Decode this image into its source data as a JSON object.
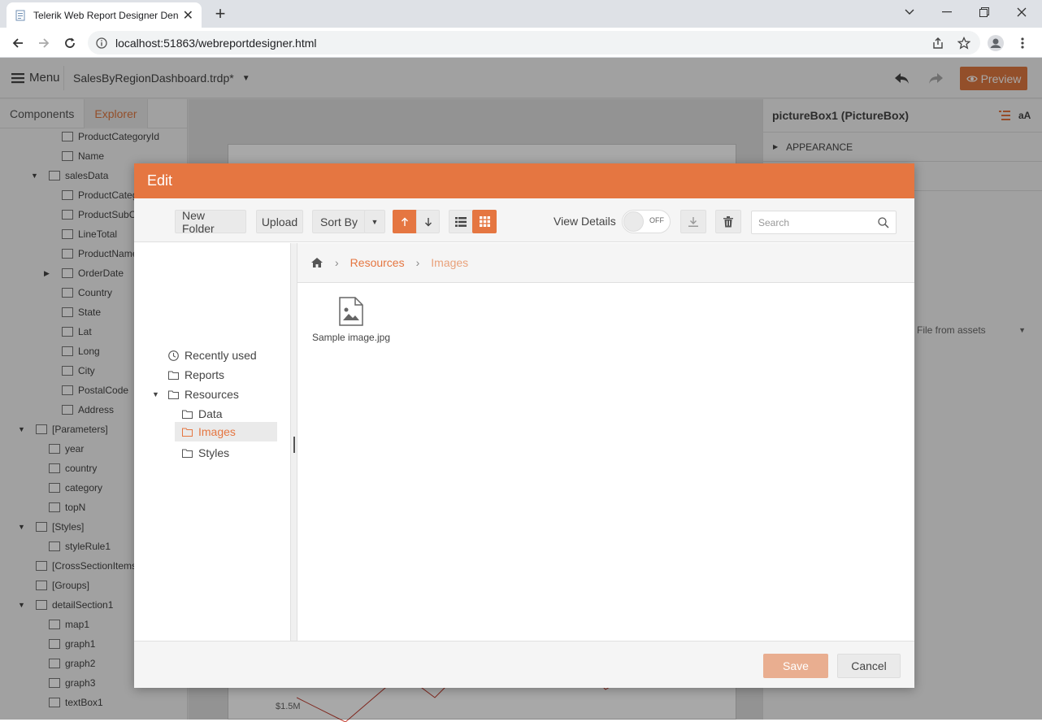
{
  "browser": {
    "tab_title": "Telerik Web Report Designer Den",
    "url": "localhost:51863/webreportdesigner.html"
  },
  "app": {
    "menu_label": "Menu",
    "report_name": "SalesByRegionDashboard.trdp*",
    "preview_label": "Preview",
    "left_tabs": [
      "Components",
      "Explorer"
    ],
    "explorer_items": [
      {
        "label": "ProductCategoryId",
        "icon": "123"
      },
      {
        "label": "Name",
        "icon": "abc"
      },
      {
        "label": "salesData",
        "icon": "db"
      },
      {
        "label": "ProductCateg",
        "icon": "abc"
      },
      {
        "label": "ProductSubCat",
        "icon": "abc"
      },
      {
        "label": "LineTotal",
        "icon": "0.1"
      },
      {
        "label": "ProductName",
        "icon": "abc"
      },
      {
        "label": "OrderDate",
        "icon": "date"
      },
      {
        "label": "Country",
        "icon": "abc"
      },
      {
        "label": "State",
        "icon": "abc"
      },
      {
        "label": "Lat",
        "icon": "0.1"
      },
      {
        "label": "Long",
        "icon": "0.1"
      },
      {
        "label": "City",
        "icon": "abc"
      },
      {
        "label": "PostalCode",
        "icon": "abc"
      },
      {
        "label": "Address",
        "icon": "abc"
      },
      {
        "label": "[Parameters]",
        "icon": "params"
      },
      {
        "label": "year",
        "icon": "123"
      },
      {
        "label": "country",
        "icon": "abc"
      },
      {
        "label": "category",
        "icon": "abc"
      },
      {
        "label": "topN",
        "icon": "123"
      },
      {
        "label": "[Styles]",
        "icon": "palette"
      },
      {
        "label": "styleRule1",
        "icon": "palette"
      },
      {
        "label": "[CrossSectionItems",
        "icon": "grid"
      },
      {
        "label": "[Groups]",
        "icon": "groups"
      },
      {
        "label": "detailSection1",
        "icon": "section"
      },
      {
        "label": "map1",
        "icon": "globe"
      },
      {
        "label": "graph1",
        "icon": "graph"
      },
      {
        "label": "graph2",
        "icon": "graph"
      },
      {
        "label": "graph3",
        "icon": "graph"
      },
      {
        "label": "textBox1",
        "icon": "abc"
      }
    ],
    "properties_title": "pictureBox1 (PictureBox)",
    "properties_icon_text": "aA",
    "appearance_label": "APPEARANCE",
    "source_select_value": "File from assets",
    "canvas_axis_label": "$1.5M"
  },
  "dialog": {
    "title": "Edit",
    "toolbar": {
      "new_folder": "New Folder",
      "upload": "Upload",
      "sort_by": "Sort By",
      "view_details": "View Details",
      "toggle_state": "OFF",
      "search_placeholder": "Search"
    },
    "folders": {
      "recently_used": "Recently used",
      "reports": "Reports",
      "resources": "Resources",
      "data": "Data",
      "images": "Images",
      "styles": "Styles"
    },
    "breadcrumb": [
      "Resources",
      "Images"
    ],
    "files": [
      {
        "name": "Sample image.jpg",
        "icon": "image-file-icon"
      }
    ],
    "save_label": "Save",
    "cancel_label": "Cancel"
  },
  "colors": {
    "accent": "#e57641",
    "accent_disabled": "#e9ae90"
  }
}
